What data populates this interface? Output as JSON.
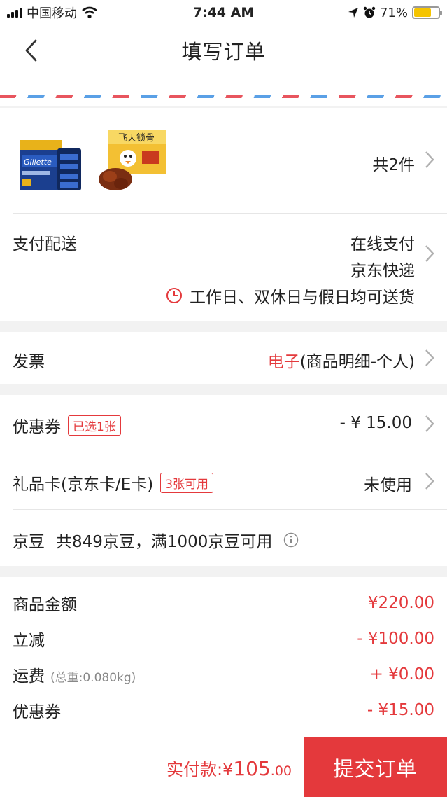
{
  "status_bar": {
    "carrier": "中国移动",
    "time": "7:44 AM",
    "battery_pct": "71%",
    "battery_level": 0.71,
    "icons": [
      "signal-icon",
      "wifi-icon",
      "location-icon",
      "alarm-icon",
      "battery-icon"
    ]
  },
  "nav": {
    "title": "填写订单",
    "back_icon": "back-chevron-icon"
  },
  "products": {
    "count_label": "共2件",
    "items": [
      {
        "name": "Gillette Fusion",
        "image_icon": "razor-pack-image"
      },
      {
        "name": "飞天锁骨",
        "image_icon": "snack-box-image"
      }
    ]
  },
  "payment_delivery": {
    "label": "支付配送",
    "payment": "在线支付",
    "courier": "京东快递",
    "schedule": "工作日、双休日与假日均可送货"
  },
  "invoice": {
    "label": "发票",
    "type": "电子",
    "detail": "(商品明细-个人)"
  },
  "coupon": {
    "label": "优惠券",
    "tag": "已选1张",
    "value": "- ¥ 15.00"
  },
  "gift_card": {
    "label": "礼品卡(京东卡/E卡)",
    "tag": "3张可用",
    "value": "未使用"
  },
  "jingdou": {
    "label": "京豆",
    "text": "共849京豆，满1000京豆可用"
  },
  "summary": {
    "rows": [
      {
        "label": "商品金额",
        "sub": "",
        "value": "¥220.00"
      },
      {
        "label": "立减",
        "sub": "",
        "value": "- ¥100.00"
      },
      {
        "label": "运费",
        "sub": "(总重:0.080kg)",
        "value": "+ ¥0.00"
      },
      {
        "label": "优惠券",
        "sub": "",
        "value": "- ¥15.00"
      }
    ]
  },
  "bottom": {
    "pay_label": "实付款:",
    "currency": "¥",
    "amount_int": "105",
    "amount_dec": ".00",
    "submit_label": "提交订单"
  },
  "colors": {
    "accent": "#e4393c",
    "background": "#f2f2f2",
    "battery": "#f5c400"
  }
}
